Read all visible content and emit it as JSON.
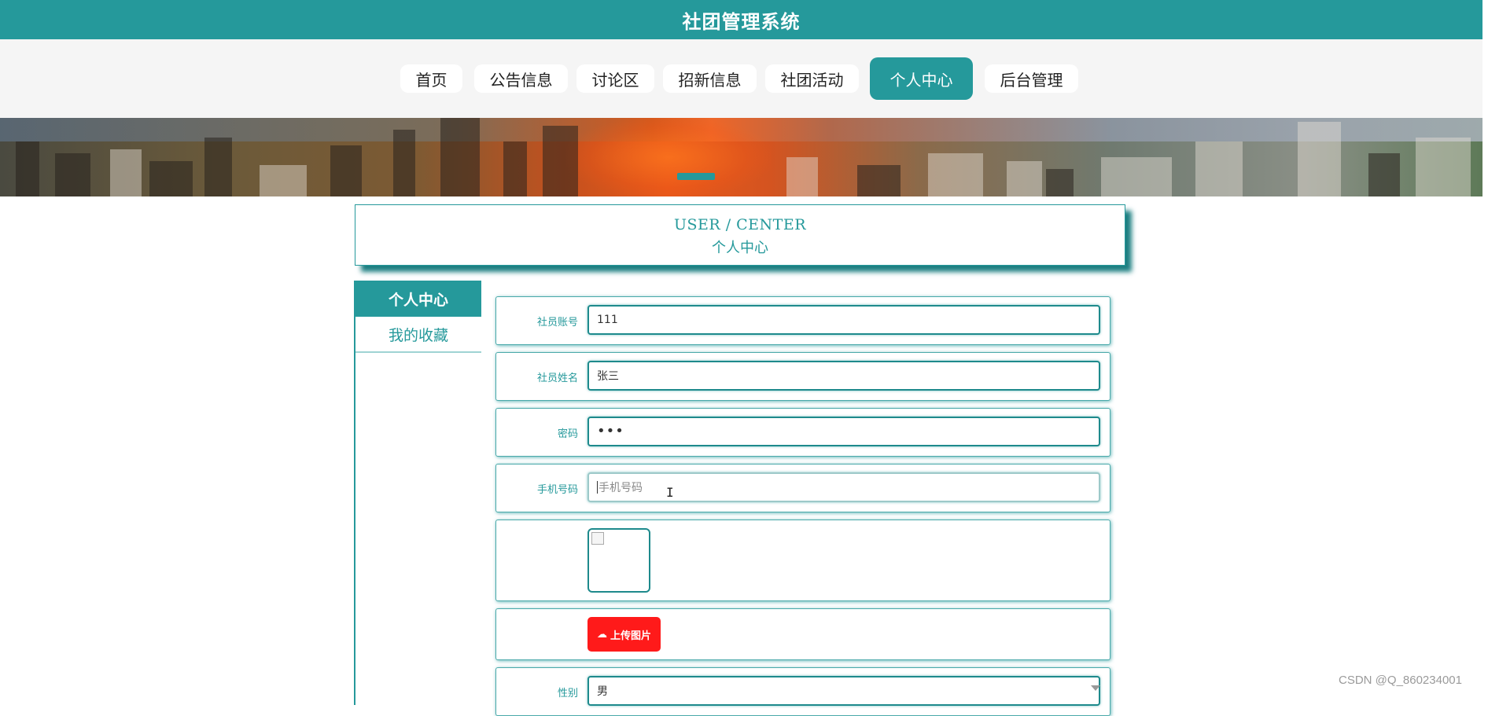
{
  "app": {
    "title": "社团管理系统"
  },
  "nav": {
    "items": [
      {
        "label": "首页",
        "active": false
      },
      {
        "label": "公告信息",
        "active": false
      },
      {
        "label": "讨论区",
        "active": false
      },
      {
        "label": "招新信息",
        "active": false
      },
      {
        "label": "社团活动",
        "active": false
      },
      {
        "label": "个人中心",
        "active": true
      },
      {
        "label": "后台管理",
        "active": false
      }
    ]
  },
  "header": {
    "en_title": "USER / CENTER",
    "cn_title": "个人中心"
  },
  "sidebar": {
    "items": [
      {
        "label": "个人中心",
        "active": true
      },
      {
        "label": "我的收藏",
        "active": false
      }
    ]
  },
  "form": {
    "account": {
      "label": "社员账号",
      "value": "111"
    },
    "name": {
      "label": "社员姓名",
      "value": "张三"
    },
    "password": {
      "label": "密码",
      "value": "•••"
    },
    "phone": {
      "label": "手机号码",
      "value": "",
      "placeholder": "手机号码"
    },
    "upload": {
      "label": "上传图片",
      "icon": "cloud-upload-icon"
    },
    "gender": {
      "label": "性别",
      "value": "男"
    }
  },
  "watermark": "CSDN @Q_860234001",
  "colors": {
    "primary": "#25999b",
    "upload": "#ff1a1a"
  }
}
